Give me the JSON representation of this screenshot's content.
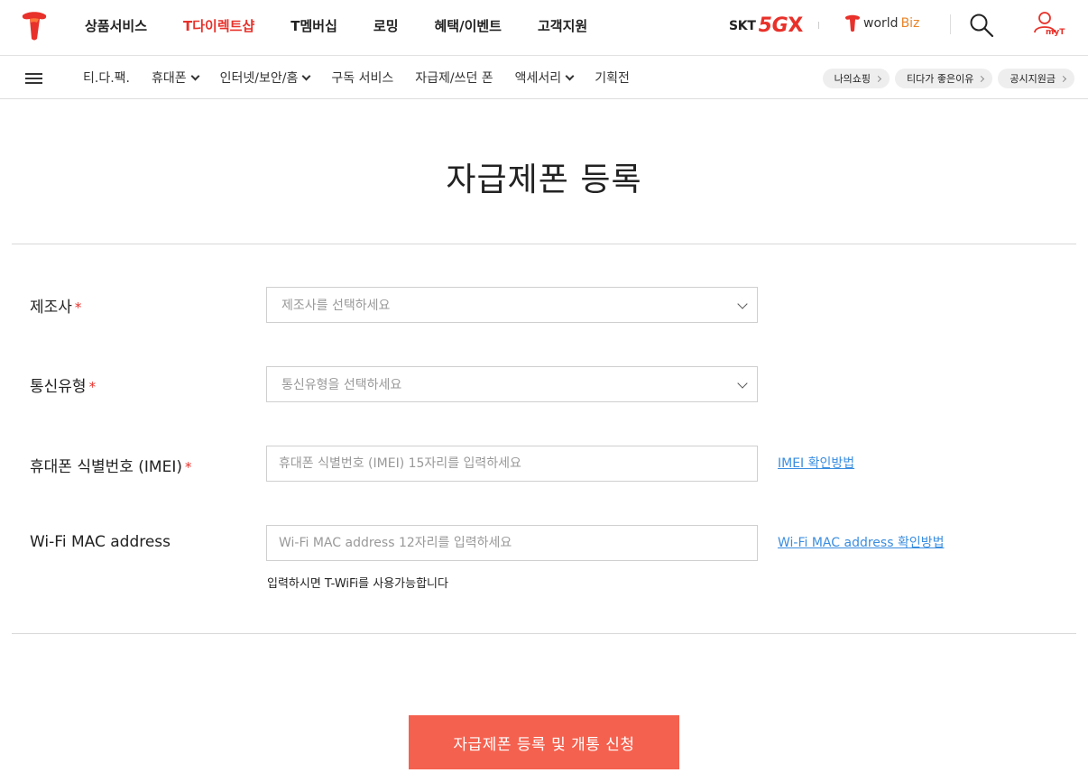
{
  "header": {
    "nav": [
      "상품서비스",
      "T다이렉트샵",
      "T멤버십",
      "로밍",
      "혜택/이벤트",
      "고객지원"
    ],
    "active_nav_index": 1,
    "brand_skt": "SKT",
    "brand_5g": "5G",
    "brand_x": "X",
    "worldbiz_world": "world",
    "worldbiz_biz": "Biz",
    "myt_label": "myT"
  },
  "subnav": {
    "items": [
      {
        "label": "티.다.팩.",
        "dropdown": false
      },
      {
        "label": "휴대폰",
        "dropdown": true
      },
      {
        "label": "인터넷/보안/홈",
        "dropdown": true
      },
      {
        "label": "구독 서비스",
        "dropdown": false
      },
      {
        "label": "자급제/쓰던 폰",
        "dropdown": false
      },
      {
        "label": "액세서리",
        "dropdown": true
      },
      {
        "label": "기획전",
        "dropdown": false
      }
    ],
    "pills": [
      "나의쇼핑",
      "티다가 좋은이유",
      "공시지원금"
    ]
  },
  "page": {
    "title": "자급제폰 등록"
  },
  "form": {
    "manufacturer": {
      "label": "제조사",
      "placeholder": "제조사를 선택하세요",
      "required": "*"
    },
    "carrier": {
      "label": "통신유형",
      "placeholder": "통신유형을 선택하세요",
      "required": "*"
    },
    "imei": {
      "label": "휴대폰 식별번호 (IMEI)",
      "placeholder": "휴대폰 식별번호 (IMEI) 15자리를 입력하세요",
      "required": "*",
      "help": "IMEI 확인방법"
    },
    "mac": {
      "label": "Wi-Fi MAC address",
      "placeholder": "Wi-Fi MAC address 12자리를 입력하세요",
      "help": "Wi-Fi MAC address 확인방법",
      "hint": "입력하시면 T-WiFi를 사용가능합니다"
    },
    "submit_label": "자급제폰 등록 및 개통 신청"
  },
  "colors": {
    "accent": "#e8312a",
    "button": "#f5614f",
    "link": "#3a8de0"
  }
}
